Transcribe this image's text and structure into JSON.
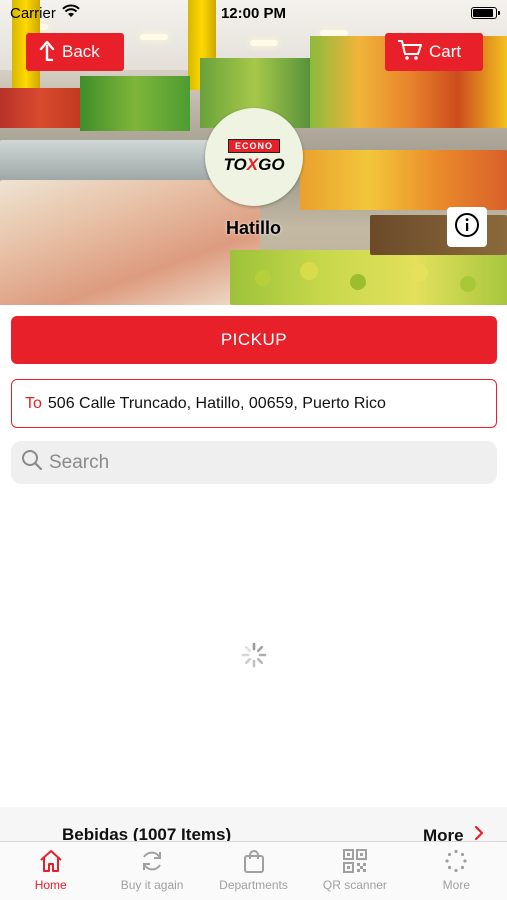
{
  "status_bar": {
    "carrier": "Carrier",
    "time": "12:00 PM"
  },
  "header": {
    "back_label": "Back",
    "cart_label": "Cart"
  },
  "store": {
    "logo_top": "ECONO",
    "logo_bottom_1": "TO",
    "logo_bottom_x": "X",
    "logo_bottom_2": "GO",
    "name": "Hatillo"
  },
  "service": {
    "pickup_label": "PICKUP"
  },
  "address": {
    "prefix": "To",
    "value": "506 Calle Truncado, Hatillo, 00659, Puerto Rico"
  },
  "search": {
    "placeholder": "Search"
  },
  "section": {
    "title": "Bebidas (1007 Items)",
    "more_label": "More"
  },
  "tabs": [
    {
      "label": "Home",
      "icon": "home-icon",
      "active": true
    },
    {
      "label": "Buy it again",
      "icon": "refresh-icon",
      "active": false
    },
    {
      "label": "Departments",
      "icon": "bag-icon",
      "active": false
    },
    {
      "label": "QR scanner",
      "icon": "qr-icon",
      "active": false
    },
    {
      "label": "More",
      "icon": "dots-icon",
      "active": false
    }
  ],
  "colors": {
    "accent": "#e8202a",
    "tab_inactive": "#a0a0a0",
    "search_bg": "#efefef"
  }
}
